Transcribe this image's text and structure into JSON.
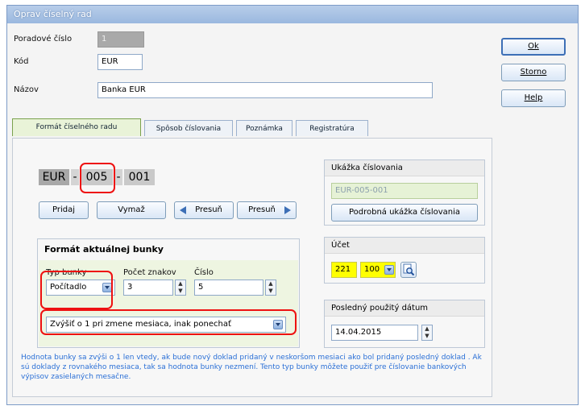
{
  "window": {
    "title": "Oprav číselný rad"
  },
  "form": {
    "poradove_label": "Poradové číslo",
    "poradove_value": "1",
    "kod_label": "Kód",
    "kod_value": "EUR",
    "nazov_label": "Názov",
    "nazov_value": "Banka EUR"
  },
  "buttons": {
    "ok": "Ok",
    "storno": "Storno",
    "help": "Help"
  },
  "tabs": [
    {
      "label": "Formát číselného radu",
      "active": true
    },
    {
      "label": "Spôsob číslovania",
      "active": false
    },
    {
      "label": "Poznámka",
      "active": false
    },
    {
      "label": "Registratúra",
      "active": false
    }
  ],
  "format": {
    "seg1": "EUR",
    "sep1": "-",
    "seg2": "005",
    "sep2": "-",
    "seg3": "001"
  },
  "cell_buttons": {
    "pridaj": "Pridaj",
    "vymaz": "Vymaž",
    "presun_left": "Presuň",
    "presun_right": "Presuň"
  },
  "current_cell": {
    "title": "Formát aktuálnej bunky",
    "typ_label": "Typ bunky",
    "typ_value": "Počítadlo",
    "pocet_label": "Počet znakov",
    "pocet_value": "3",
    "cislo_label": "Číslo",
    "cislo_value": "5",
    "rule_value": "Zvýšiť o 1 pri zmene mesiaca, inak ponechať"
  },
  "preview": {
    "title": "Ukážka číslovania",
    "value": "EUR-005-001",
    "detail_button": "Podrobná ukážka číslovania"
  },
  "account": {
    "title": "Účet",
    "synt": "221",
    "anal": "100"
  },
  "last_date": {
    "title": "Posledný použitý dátum",
    "value": "14.04.2015"
  },
  "info_text": "Hodnota bunky sa zvýši o 1 len vtedy, ak bude nový doklad pridaný v neskoršom mesiaci ako bol pridaný posledný doklad . Ak sú doklady z rovnakého mesiaca, tak sa hodnota bunky nezmení. Tento typ bunky môžete použiť pre číslovanie bankových výpisov zasielaných mesačne.",
  "colors": {
    "accent_red": "#e11111",
    "info_blue": "#2a6fd6",
    "account_yellow": "#ffff00",
    "tab_green": "#e9f3d8"
  },
  "icons": {
    "ok": "ok-icon",
    "lookup": "search-icon"
  }
}
